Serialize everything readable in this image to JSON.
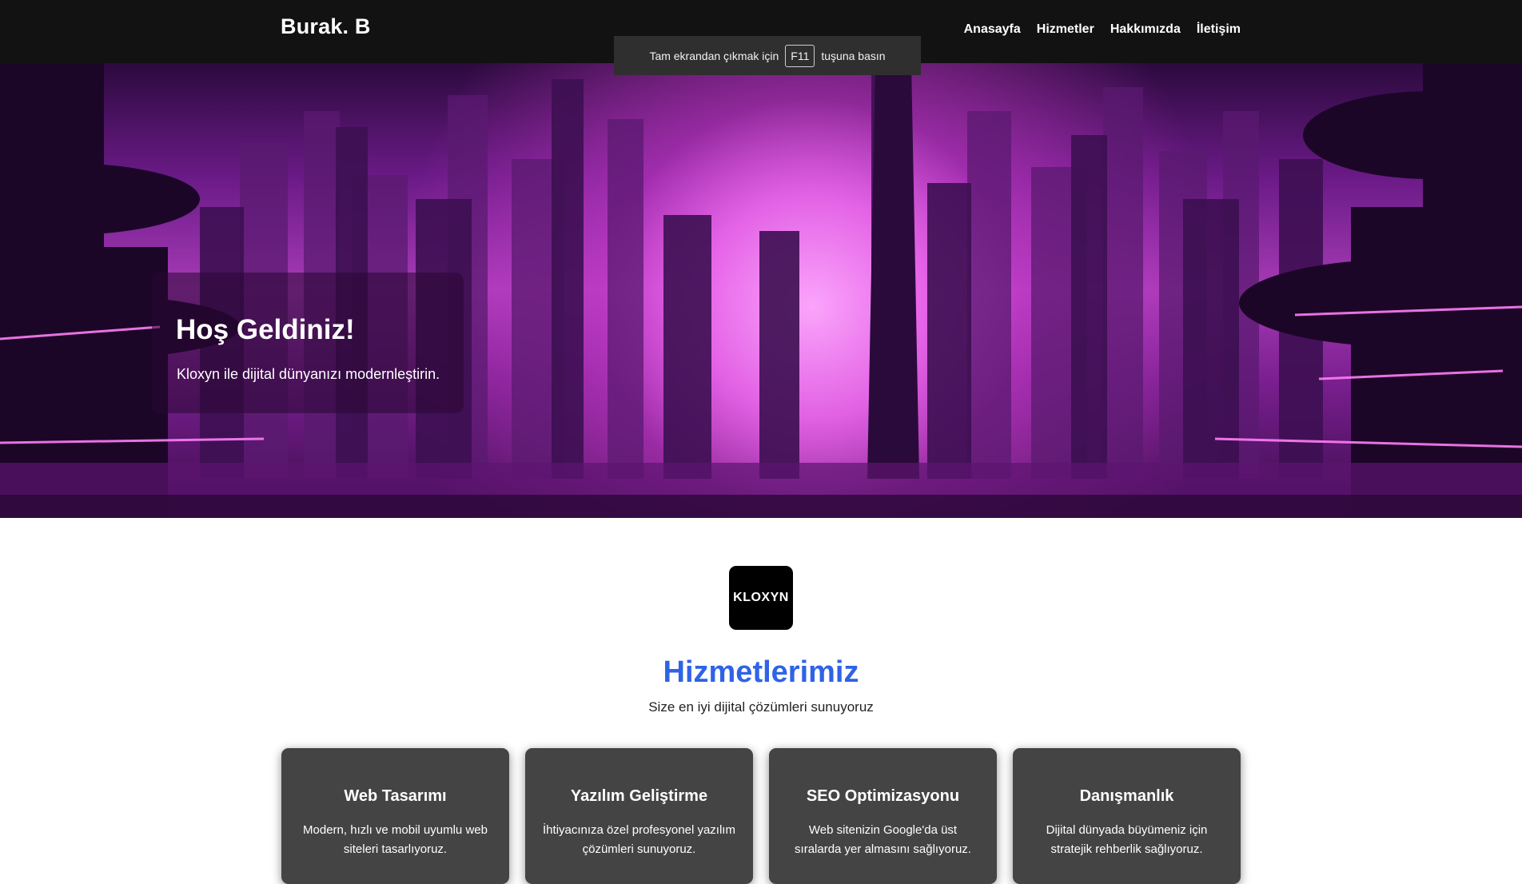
{
  "header": {
    "brand": "Burak. B",
    "nav": [
      "Anasayfa",
      "Hizmetler",
      "Hakkımızda",
      "İletişim"
    ]
  },
  "fullscreen_notice": {
    "before": "Tam ekrandan çıkmak için",
    "key": "F11",
    "after": "tuşuna basın"
  },
  "hero": {
    "title": "Hoş Geldiniz!",
    "subtitle": "Kloxyn ile dijital dünyanızı modernleştirin."
  },
  "logo": {
    "text": "KLOXYN"
  },
  "services": {
    "title": "Hizmetlerimiz",
    "subtitle": "Size en iyi dijital çözümleri sunuyoruz",
    "items": [
      {
        "title": "Web Tasarımı",
        "text": "Modern, hızlı ve mobil uyumlu web siteleri tasarlıyoruz."
      },
      {
        "title": "Yazılım Geliştirme",
        "text": "İhtiyacınıza özel profesyonel yazılım çözümleri sunuyoruz."
      },
      {
        "title": "SEO Optimizasyonu",
        "text": "Web sitenizin Google'da üst sıralarda yer almasını sağlıyoruz."
      },
      {
        "title": "Danışmanlık",
        "text": "Dijital dünyada büyümeniz için stratejik rehberlik sağlıyoruz."
      }
    ]
  },
  "colors": {
    "header_bg": "#121212",
    "accent": "#2f63e6",
    "card_bg": "#444444",
    "hero_tint": "#a73bb7"
  }
}
